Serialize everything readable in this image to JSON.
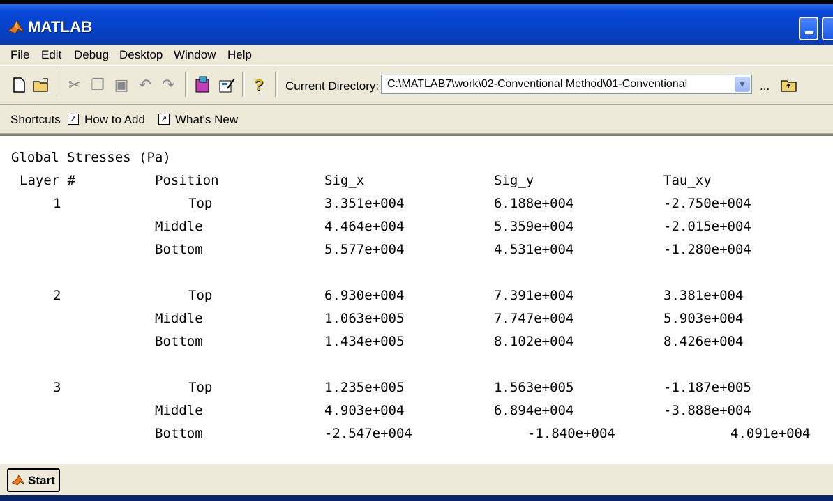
{
  "window": {
    "title": "MATLAB"
  },
  "menu": [
    "File",
    "Edit",
    "Debug",
    "Desktop",
    "Window",
    "Help"
  ],
  "toolbar": {
    "current_directory_label": "Current Directory:",
    "current_directory_value": "C:\\MATLAB7\\work\\02-Conventional Method\\01-Conventional",
    "browse_label": "..."
  },
  "shortcuts": {
    "label": "Shortcuts",
    "how_to_add": "How to Add",
    "whats_new": "What's New"
  },
  "console": {
    "heading": "Global Stresses (Pa)",
    "columns": [
      "Layer #",
      "Position",
      "Sig_x",
      "Sig_y",
      "Tau_xy"
    ],
    "layers": [
      {
        "layer": "1",
        "rows": [
          {
            "position": "Top",
            "sig_x": "3.351e+004",
            "sig_y": "6.188e+004",
            "tau_xy": "-2.750e+004"
          },
          {
            "position": "Middle",
            "sig_x": "4.464e+004",
            "sig_y": "5.359e+004",
            "tau_xy": "-2.015e+004"
          },
          {
            "position": "Bottom",
            "sig_x": "5.577e+004",
            "sig_y": "4.531e+004",
            "tau_xy": "-1.280e+004"
          }
        ]
      },
      {
        "layer": "2",
        "rows": [
          {
            "position": "Top",
            "sig_x": "6.930e+004",
            "sig_y": "7.391e+004",
            "tau_xy": "3.381e+004"
          },
          {
            "position": "Middle",
            "sig_x": "1.063e+005",
            "sig_y": "7.747e+004",
            "tau_xy": "5.903e+004"
          },
          {
            "position": "Bottom",
            "sig_x": "1.434e+005",
            "sig_y": "8.102e+004",
            "tau_xy": "8.426e+004"
          }
        ]
      },
      {
        "layer": "3",
        "rows": [
          {
            "position": "Top",
            "sig_x": "1.235e+005",
            "sig_y": "1.563e+005",
            "tau_xy": "-1.187e+005"
          },
          {
            "position": "Middle",
            "sig_x": "4.903e+004",
            "sig_y": "6.894e+004",
            "tau_xy": "-3.888e+004"
          },
          {
            "position": "Bottom",
            "sig_x": "-2.547e+004",
            "sig_y": "-1.840e+004",
            "tau_xy": "4.091e+004"
          }
        ]
      }
    ]
  },
  "status": {
    "start_label": "Start"
  }
}
